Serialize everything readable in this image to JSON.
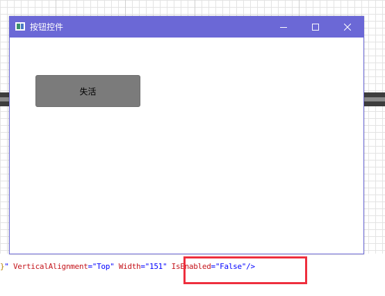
{
  "window": {
    "title": "按钮控件",
    "accent_color": "#6b68d6",
    "icons": {
      "app": "app-window-icon",
      "minimize": "minimize-icon",
      "maximize": "maximize-icon",
      "close": "close-icon"
    }
  },
  "client": {
    "button": {
      "label": "失活",
      "enabled": false,
      "background": "#7b7b7b"
    }
  },
  "code": {
    "prefix_brace": "}",
    "prefix_quote": "\"",
    "attr1_name": "VerticalAlignment",
    "attr1_value": "=\"Top\"",
    "attr2_name": "Width",
    "attr2_value": "=\"151\"",
    "attr3_name": "IsEnabled",
    "attr3_value": "=\"False\"",
    "tag_end": "/>"
  },
  "annotation": {
    "highlight_color": "#ee2e3d"
  }
}
